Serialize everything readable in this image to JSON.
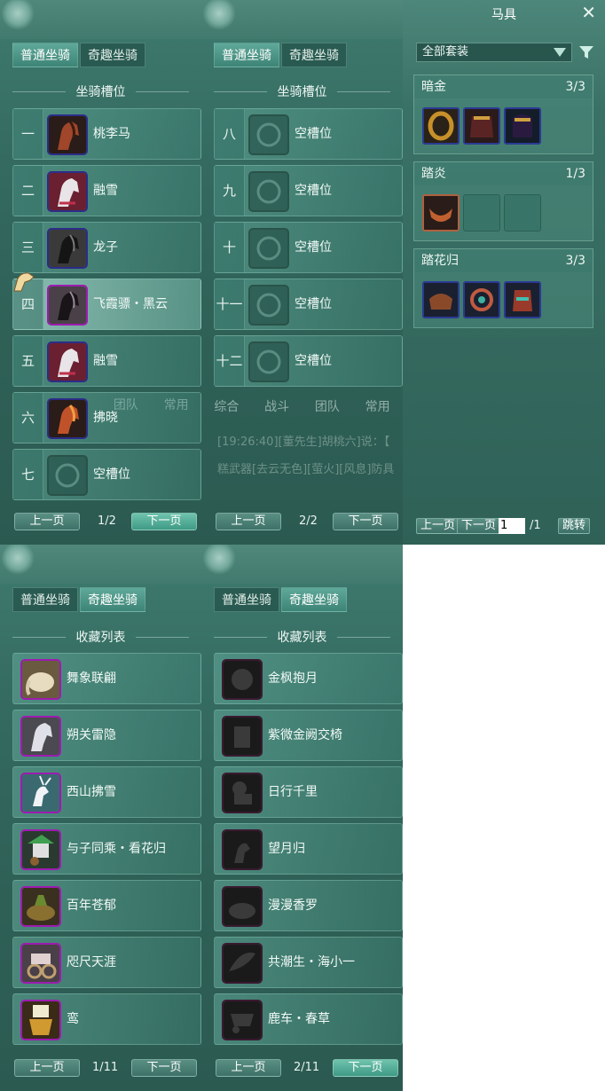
{
  "tabs": {
    "normal": "普通坐骑",
    "fun": "奇趣坐骑"
  },
  "slot_title": "坐骑槽位",
  "collection_title": "收藏列表",
  "pager": {
    "prev": "上一页",
    "next": "下一页"
  },
  "panel1": {
    "slots": [
      {
        "num": "一",
        "name": "桃李马"
      },
      {
        "num": "二",
        "name": "融雪"
      },
      {
        "num": "三",
        "name": "龙子"
      },
      {
        "num": "四",
        "name": "飞霞骠・黑云"
      },
      {
        "num": "五",
        "name": "融雪"
      },
      {
        "num": "六",
        "name": "拂晓"
      },
      {
        "num": "七",
        "name": "空槽位"
      }
    ],
    "page": "1/2"
  },
  "panel2": {
    "slots": [
      {
        "num": "八",
        "name": "空槽位"
      },
      {
        "num": "九",
        "name": "空槽位"
      },
      {
        "num": "十",
        "name": "空槽位"
      },
      {
        "num": "十一",
        "name": "空槽位"
      },
      {
        "num": "十二",
        "name": "空槽位"
      }
    ],
    "page": "2/2",
    "chat_tabs": [
      "综合",
      "战斗",
      "团队",
      "常用"
    ],
    "chat_line1": "[19:26:40][董先生]胡桃六]说：【",
    "chat_line2": "糕武器[去云无色][萤火][风息]防具"
  },
  "panel3": {
    "items": [
      "舞象联翩",
      "朔关雷隐",
      "西山拂雪",
      "与子同乘・看花归",
      "百年苍郁",
      "咫尺天涯",
      "鸾"
    ],
    "page": "1/11"
  },
  "panel4": {
    "items": [
      "金枫抱月",
      "紫微金阙交椅",
      "日行千里",
      "望月归",
      "漫漫香罗",
      "共潮生・海小一",
      "鹿车・春草"
    ],
    "page": "2/11"
  },
  "gear": {
    "title": "马具",
    "filter_value": "全部套装",
    "sets": [
      {
        "name": "暗金",
        "count": "3/3"
      },
      {
        "name": "踏炎",
        "count": "1/3"
      },
      {
        "name": "踏花归",
        "count": "3/3"
      }
    ],
    "prev": "上一页",
    "next": "下一页",
    "page_input": "1",
    "page_total": "/1",
    "jump": "跳转"
  },
  "colors": {
    "bg": "#346a60",
    "accent": "#5fa99a",
    "rare_border": "#2c2c88",
    "epic_border": "#9d1bb0"
  }
}
